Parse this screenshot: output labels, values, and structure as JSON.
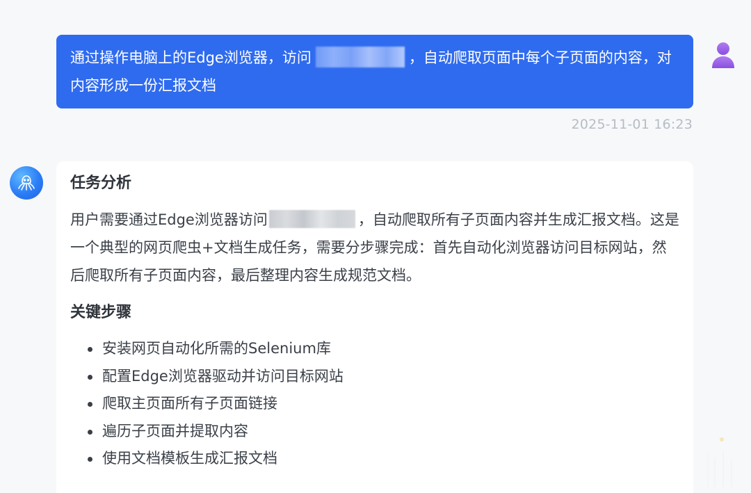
{
  "user_message": {
    "text_before_link": "通过操作电脑上的Edge浏览器，访问",
    "text_after_link": "，自动爬取页面中每个子页面的内容，对内容形成一份汇报文档",
    "timestamp": "2025-11-01 16:23",
    "avatar_icon": "user-icon"
  },
  "assistant_message": {
    "avatar_icon": "octopus-icon",
    "analysis_title": "任务分析",
    "analysis_before_link": "用户需要通过Edge浏览器访问",
    "analysis_after_link": "，自动爬取所有子页面内容并生成汇报文档。这是一个典型的网页爬虫+文档生成任务，需要分步骤完成：首先自动化浏览器访问目标网站，然后爬取所有子页面内容，最后整理内容生成规范文档。",
    "steps_title": "关键步骤",
    "steps": [
      "安装网页自动化所需的Selenium库",
      "配置Edge浏览器驱动并访问目标网站",
      "爬取主页面所有子页面链接",
      "遍历子页面并提取内容",
      "使用文档模板生成汇报文档"
    ]
  },
  "colors": {
    "user_bubble": "#2f6bef",
    "avatar_purple": "#9b5de5",
    "bot_avatar_blue": "#2b7df5",
    "timestamp_gray": "#b7bcc4"
  }
}
